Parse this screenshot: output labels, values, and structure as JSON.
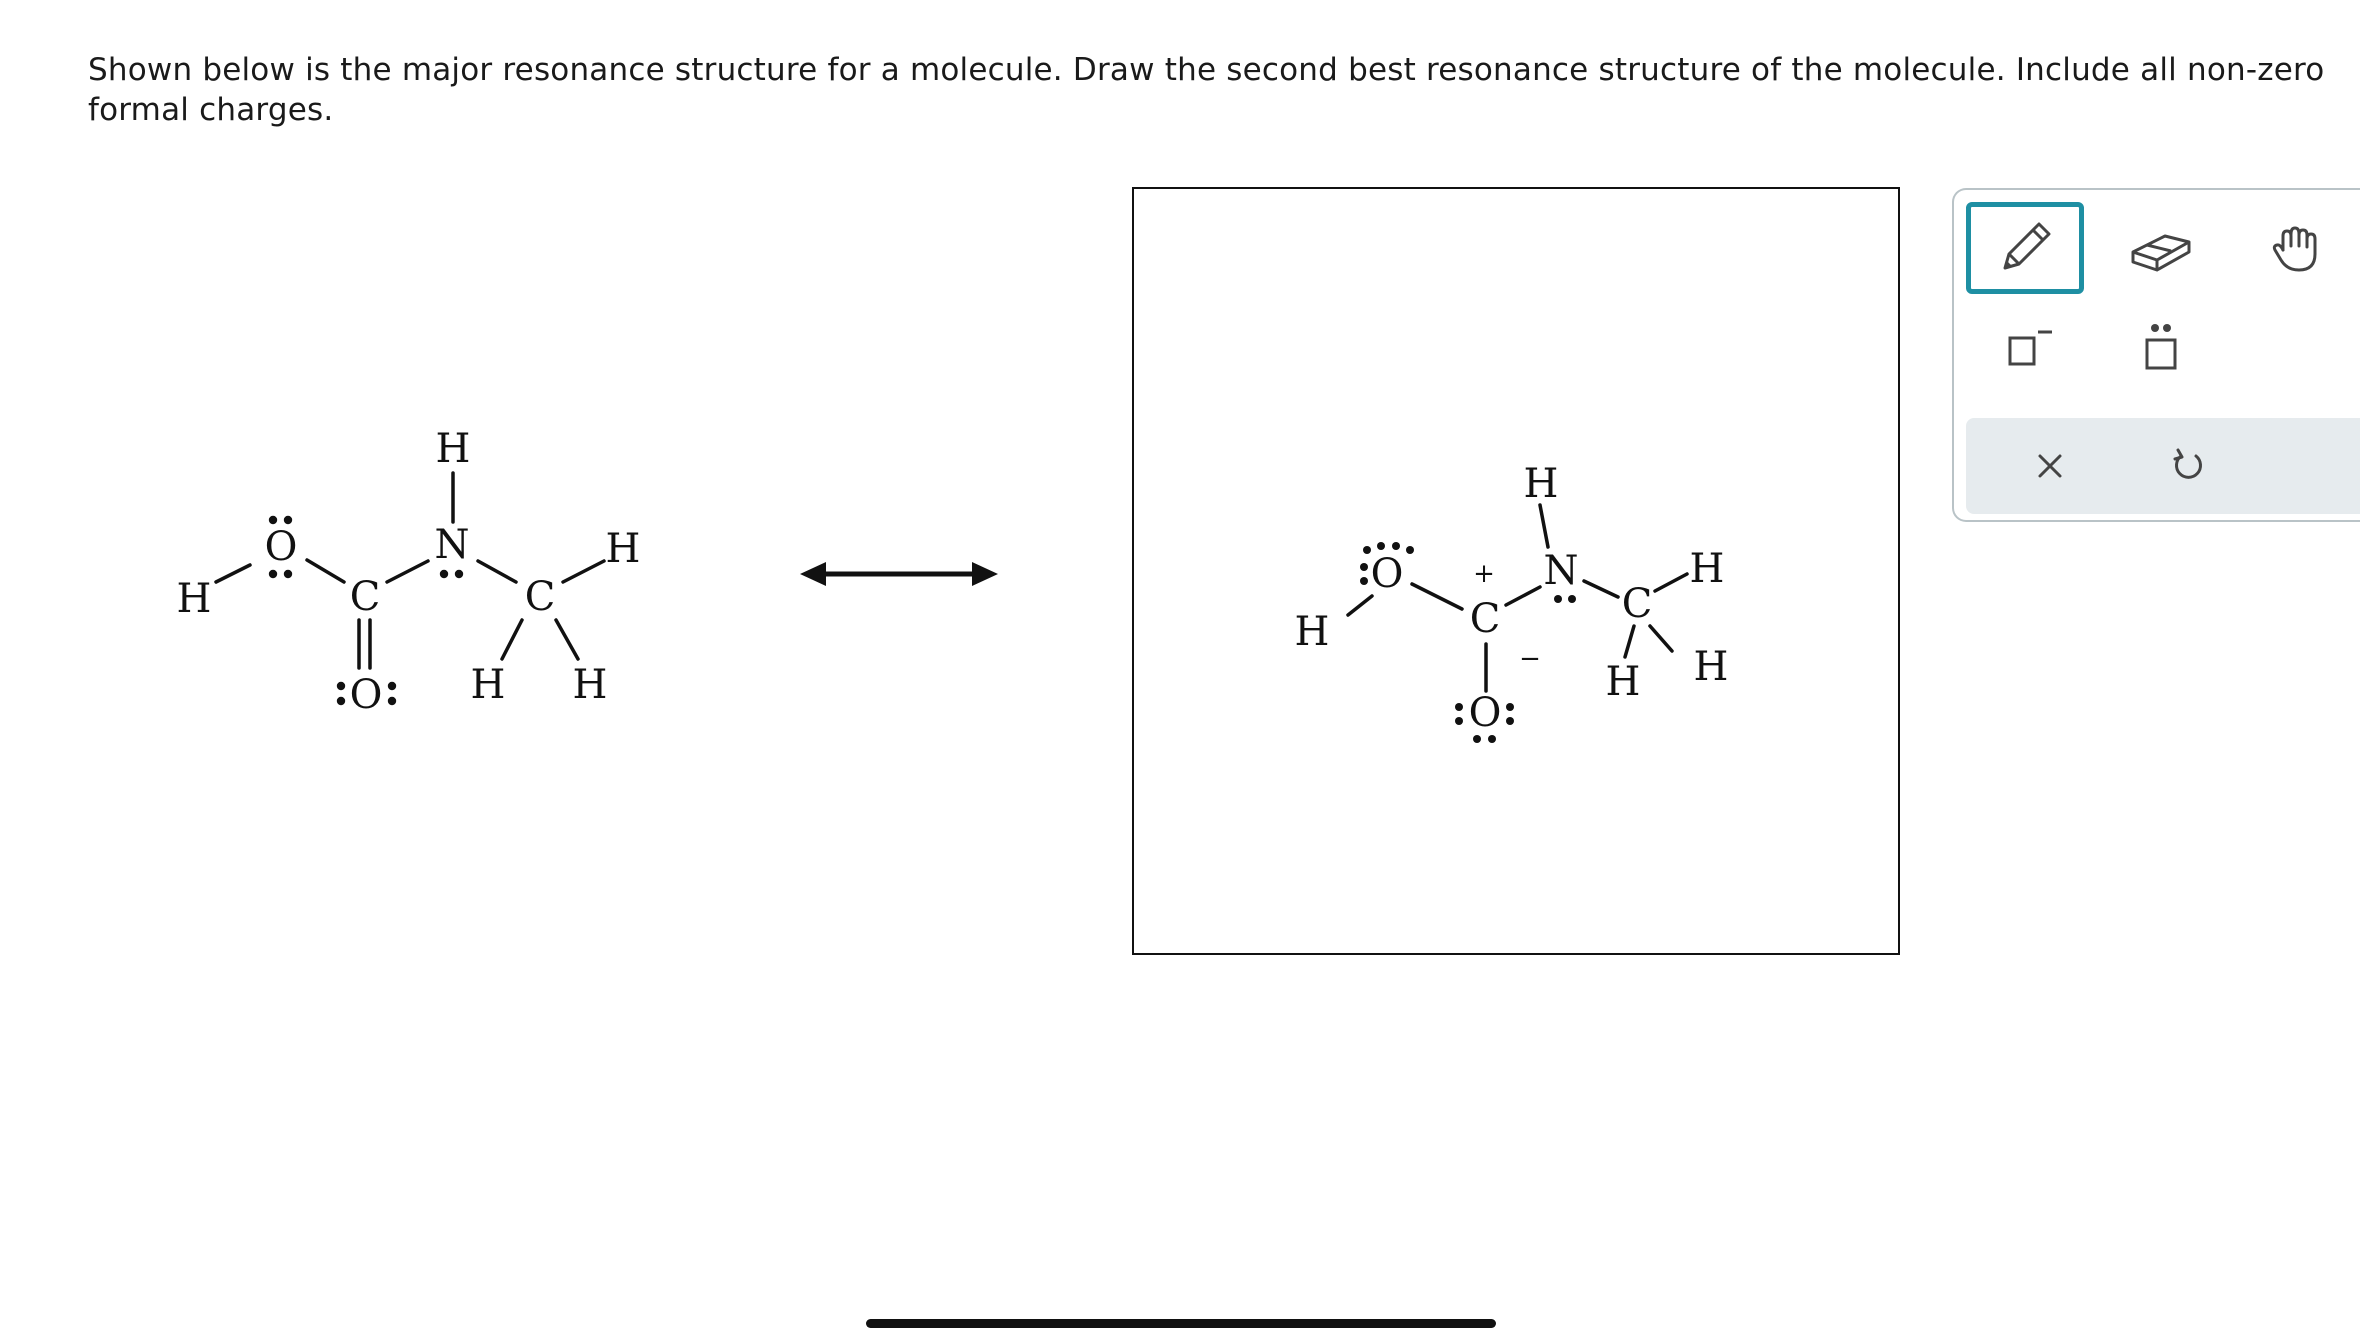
{
  "question": {
    "text": "Shown below is the major resonance structure for a molecule. Draw the second best resonance structure of the molecule. Include all non-zero formal charges."
  },
  "atoms": {
    "H": "H",
    "O": "O",
    "C": "C",
    "N": "N"
  },
  "charges": {
    "plus": "+",
    "minus": "−"
  },
  "toolbar": {
    "tools": [
      "pencil-icon",
      "eraser-icon",
      "hand-icon",
      "charge-icon",
      "lone-pair-icon"
    ],
    "actions": [
      "clear-icon",
      "undo-icon"
    ],
    "accent": "#1e8fa3"
  }
}
